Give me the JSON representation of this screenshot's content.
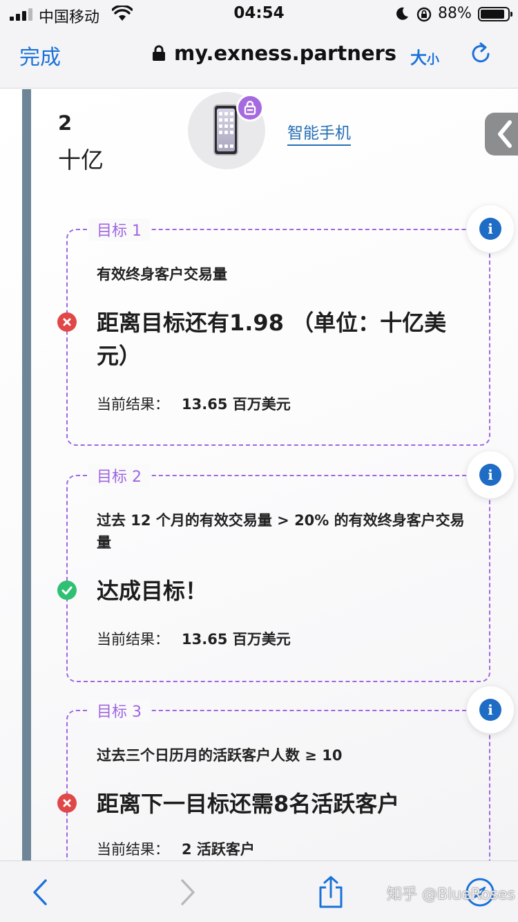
{
  "status_bar": {
    "carrier": "中国移动",
    "time": "04:54",
    "battery_percent": "88%"
  },
  "nav": {
    "done_label": "完成",
    "url": "my.exness.partners",
    "text_size_big": "大",
    "text_size_small": "小"
  },
  "level": {
    "value": "2",
    "unit": "十亿"
  },
  "device": {
    "link_label": "智能手机"
  },
  "goals": [
    {
      "label": "目标 1",
      "description": "有效终身客户交易量",
      "status": "距离目标还有1.98 （单位：十亿美元）",
      "status_type": "fail",
      "current_label": "当前结果：",
      "current_value": "13.65 百万美元"
    },
    {
      "label": "目标 2",
      "description": "过去 12 个月的有效交易量 > 20% 的有效终身客户交易量",
      "status": "达成目标！",
      "status_type": "ok",
      "current_label": "当前结果：",
      "current_value": "13.65 百万美元"
    },
    {
      "label": "目标 3",
      "description": "过去三个日历月的活跃客户人数 ≥ 10",
      "status": "距离下一目标还需8名活跃客户",
      "status_type": "fail",
      "current_label": "当前结果：",
      "current_value": "2 活跃客户"
    }
  ],
  "info_icon_glyph": "i",
  "watermark": "知乎 @BlueRoses",
  "colors": {
    "accent_blue": "#1a72d8",
    "goal_purple": "#9e66e0",
    "fail_red": "#e04848",
    "ok_green": "#2fc073",
    "sidebar_slate": "#6e8598"
  }
}
